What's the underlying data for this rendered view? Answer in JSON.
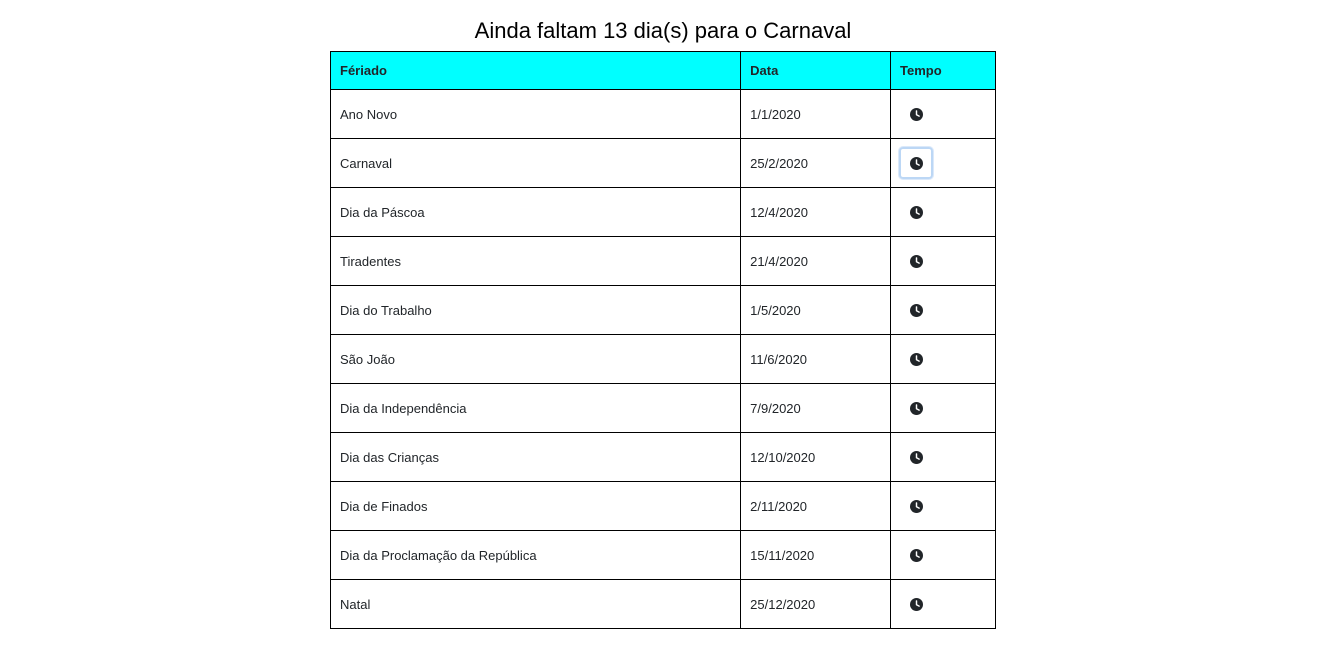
{
  "page": {
    "title": "Ainda faltam 13 dia(s) para o Carnaval"
  },
  "colors": {
    "header_bg": "#00ffff",
    "border": "#000000",
    "focus_ring": "#bcd7f5",
    "icon": "#212529"
  },
  "table": {
    "headers": [
      "Fériado",
      "Data",
      "Tempo"
    ],
    "time_icon": "clock-icon",
    "rows": [
      {
        "name": "Ano Novo",
        "date": "1/1/2020"
      },
      {
        "name": "Carnaval",
        "date": "25/2/2020",
        "focused": true
      },
      {
        "name": "Dia da Páscoa",
        "date": "12/4/2020"
      },
      {
        "name": "Tiradentes",
        "date": "21/4/2020"
      },
      {
        "name": "Dia do Trabalho",
        "date": "1/5/2020"
      },
      {
        "name": "São João",
        "date": "11/6/2020"
      },
      {
        "name": "Dia da Independência",
        "date": "7/9/2020"
      },
      {
        "name": "Dia das Crianças",
        "date": "12/10/2020"
      },
      {
        "name": "Dia de Finados",
        "date": "2/11/2020"
      },
      {
        "name": "Dia da Proclamação da República",
        "date": "15/11/2020"
      },
      {
        "name": "Natal",
        "date": "25/12/2020"
      }
    ]
  }
}
